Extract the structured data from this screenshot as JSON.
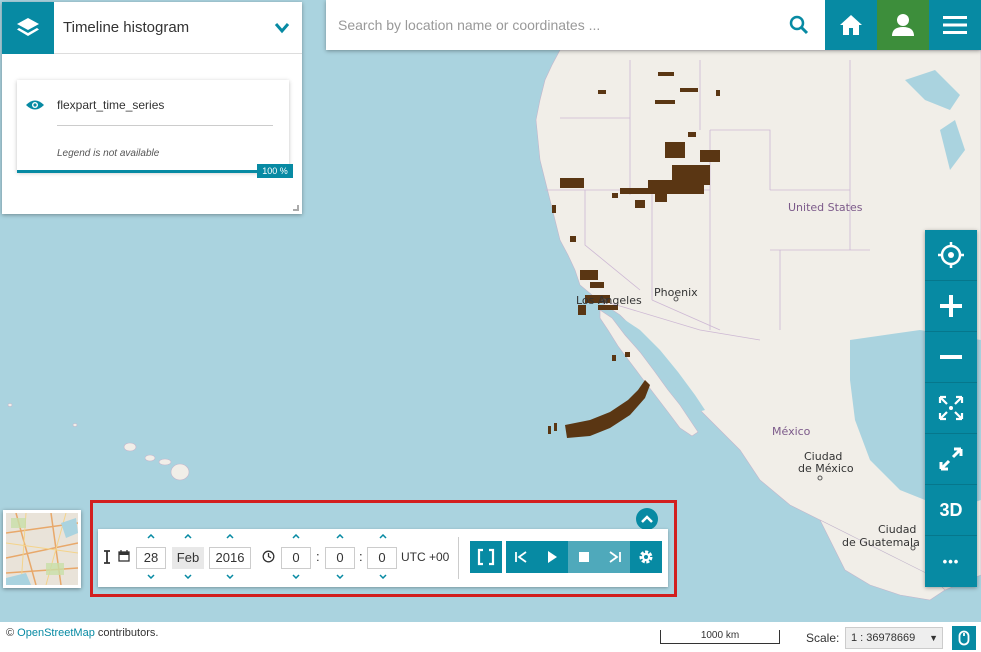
{
  "layers_panel": {
    "title": "Timeline histogram",
    "layer": {
      "name": "flexpart_time_series",
      "legend_text": "Legend is not available",
      "opacity_label": "100 %",
      "opacity": 1.0
    }
  },
  "search": {
    "placeholder": "Search by location name or coordinates ..."
  },
  "map_labels": {
    "country_us": "United States",
    "city_phoenix": "Phoenix",
    "city_la": "Los Angeles",
    "country_mexico": "México",
    "city_cdmx_1": "Ciudad",
    "city_cdmx_2": "de México",
    "city_gt_1": "Ciudad",
    "city_gt_2": "de Guatemala"
  },
  "toolbar": {
    "btn_3d": "3D",
    "btn_more": "•••"
  },
  "timeline": {
    "day": "28",
    "month": "Feb",
    "year": "2016",
    "hour": "0",
    "minute": "0",
    "second": "0",
    "timezone": "UTC +00",
    "time_sep": ":"
  },
  "footer": {
    "copyright": "© ",
    "osm_link": "OpenStreetMap",
    "contributors": " contributors.",
    "scalebar": "1000 km",
    "scale_label": "Scale:",
    "scale_value": "1 : 36978669"
  },
  "colors": {
    "accent": "#078aa3",
    "user_green": "#3d8e3b",
    "highlight": "#d21f1f",
    "plume": "#5a3613"
  }
}
